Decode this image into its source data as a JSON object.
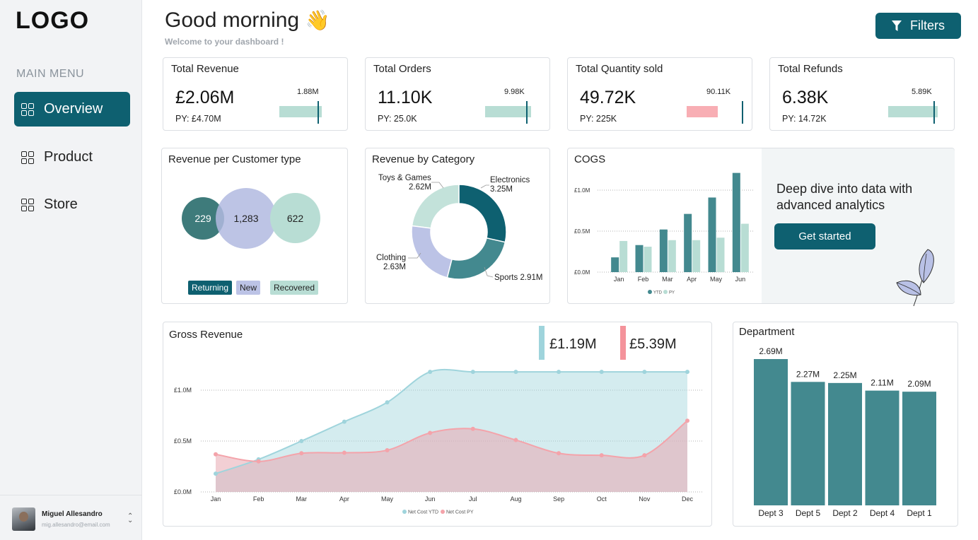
{
  "sidebar": {
    "logo": "LOGO",
    "menu_title": "MAIN MENU",
    "items": [
      {
        "label": "Overview",
        "active": true
      },
      {
        "label": "Product",
        "active": false
      },
      {
        "label": "Store",
        "active": false
      }
    ],
    "user": {
      "name": "Miguel Allesandro",
      "email": "mig.allesandro@email.com"
    }
  },
  "header": {
    "greeting": "Good morning",
    "greeting_emoji": "👋",
    "subtitle": "Welcome to your dashboard !",
    "filters_label": "Filters"
  },
  "kpis": [
    {
      "title": "Total Revenue",
      "value": "£2.06M",
      "py": "PY: £4.70M",
      "target": "1.88M",
      "status": "good"
    },
    {
      "title": "Total Orders",
      "value": "11.10K",
      "py": "PY: 25.0K",
      "target": "9.98K",
      "status": "good"
    },
    {
      "title": "Total Quantity sold",
      "value": "49.72K",
      "py": "PY: 225K",
      "target": "90.11K",
      "status": "bad"
    },
    {
      "title": "Total Refunds",
      "value": "6.38K",
      "py": "PY: 14.72K",
      "target": "5.89K",
      "status": "good"
    }
  ],
  "colors": {
    "primary": "#0e6070",
    "teal": "#43898f",
    "mint": "#b8ddd4",
    "lavender": "#bcc3e6",
    "pink": "#f4a3aa",
    "light_blue": "#9fd4dc"
  },
  "customer_type": {
    "title": "Revenue per Customer type",
    "segments": [
      {
        "label": "Returning",
        "value": "229",
        "color": "#3e7b7b"
      },
      {
        "label": "New",
        "value": "1,283",
        "color": "#bcc3e6"
      },
      {
        "label": "Recovered",
        "value": "622",
        "color": "#b8ddd4"
      }
    ]
  },
  "cogs_panel": {
    "cta_text": "Deep dive into data with advanced analytics",
    "cta_button": "Get started"
  },
  "gross_revenue": {
    "ytd_total": "£1.19M",
    "py_total": "£5.39M"
  },
  "chart_data": [
    {
      "type": "pie",
      "title": "Revenue by Category",
      "donut": true,
      "slices": [
        {
          "label": "Electronics",
          "value_label": "3.25M",
          "value": 3.25,
          "color": "#0e6070"
        },
        {
          "label": "Sports",
          "value_label": "2.91M",
          "value": 2.91,
          "color": "#43898f"
        },
        {
          "label": "Clothing",
          "value_label": "2.63M",
          "value": 2.63,
          "color": "#bcc3e6"
        },
        {
          "label": "Toys & Games",
          "value_label": "2.62M",
          "value": 2.62,
          "color": "#c3e2da"
        }
      ]
    },
    {
      "type": "bar",
      "title": "COGS",
      "categories": [
        "Jan",
        "Feb",
        "Mar",
        "Apr",
        "May",
        "Jun"
      ],
      "series": [
        {
          "name": "YTD",
          "color": "#43898f",
          "values": [
            0.18,
            0.33,
            0.52,
            0.71,
            0.91,
            1.21
          ]
        },
        {
          "name": "PY",
          "color": "#b8ddd4",
          "values": [
            0.38,
            0.31,
            0.39,
            0.39,
            0.42,
            0.59
          ]
        }
      ],
      "ylim": [
        0,
        1.25
      ],
      "yticks": [
        {
          "v": 0,
          "label": "£0.0M"
        },
        {
          "v": 0.5,
          "label": "£0.5M"
        },
        {
          "v": 1.0,
          "label": "£1.0M"
        }
      ],
      "grid": true,
      "legend": "bottom"
    },
    {
      "type": "area",
      "title": "Gross Revenue",
      "categories": [
        "Jan",
        "Feb",
        "Mar",
        "Apr",
        "May",
        "Jun",
        "Jul",
        "Aug",
        "Sep",
        "Oct",
        "Nov",
        "Dec"
      ],
      "series": [
        {
          "name": "Net Cost YTD",
          "color": "#9fd4dc",
          "values": [
            0.18,
            0.32,
            0.5,
            0.69,
            0.88,
            1.18,
            1.18,
            1.18,
            1.18,
            1.18,
            1.18,
            1.18
          ]
        },
        {
          "name": "Net Cost PY",
          "color": "#f4a3aa",
          "values": [
            0.37,
            0.3,
            0.38,
            0.385,
            0.41,
            0.58,
            0.62,
            0.51,
            0.38,
            0.36,
            0.36,
            0.7
          ]
        }
      ],
      "ylim": [
        0,
        1.25
      ],
      "yticks": [
        {
          "v": 0,
          "label": "£0.0M"
        },
        {
          "v": 0.5,
          "label": "£0.5M"
        },
        {
          "v": 1.0,
          "label": "£1.0M"
        }
      ],
      "grid": true,
      "legend": "bottom"
    },
    {
      "type": "bar",
      "title": "Department",
      "categories": [
        "Dept 3",
        "Dept 5",
        "Dept 2",
        "Dept 4",
        "Dept 1"
      ],
      "values": [
        2.69,
        2.27,
        2.25,
        2.11,
        2.09
      ],
      "value_labels": [
        "2.69M",
        "2.27M",
        "2.25M",
        "2.11M",
        "2.09M"
      ],
      "color": "#43898f",
      "ylim": [
        0,
        2.69
      ]
    }
  ]
}
